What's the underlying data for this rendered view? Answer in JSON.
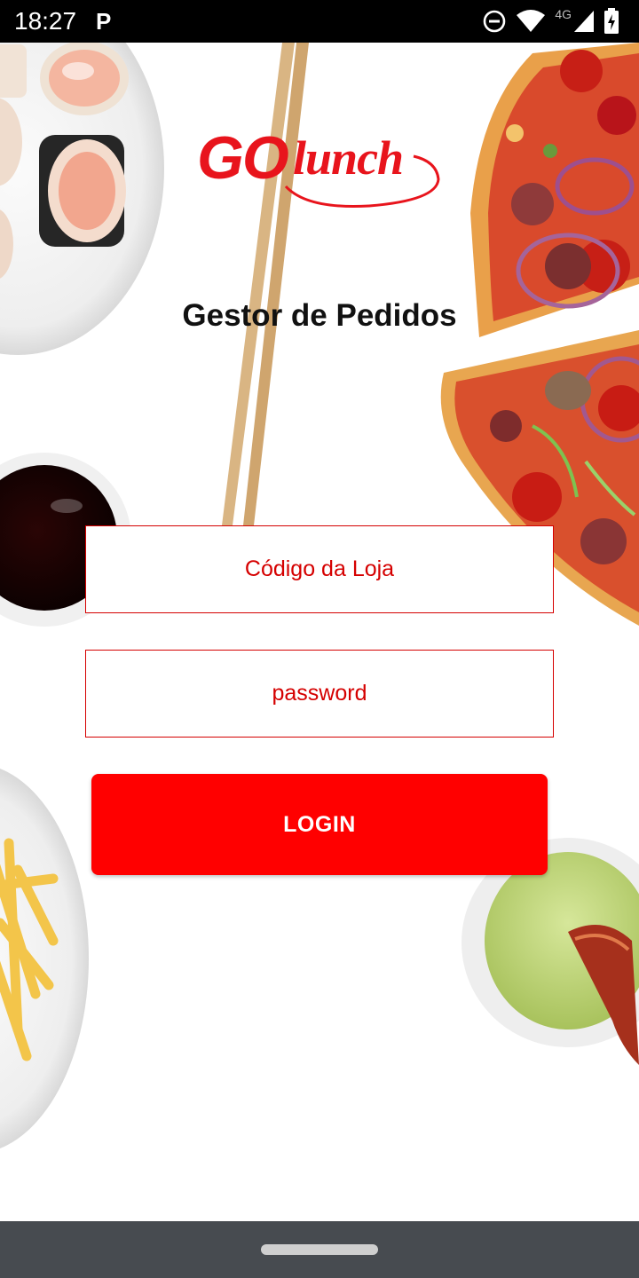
{
  "status_bar": {
    "time": "18:27",
    "notification": "P",
    "network": "4G",
    "icons": [
      "dnd-icon",
      "wifi-icon",
      "signal-icon",
      "battery-charging-icon"
    ]
  },
  "app": {
    "logo_text_1": "GO",
    "logo_text_2": "lunch",
    "title": "Gestor de Pedidos"
  },
  "form": {
    "store_code_placeholder": "Código da Loja",
    "password_placeholder": "password",
    "login_label": "LOGIN"
  },
  "colors": {
    "brand_red": "#e8141c",
    "button_red": "#ff0000",
    "field_border": "#d50000",
    "nav_bar": "#474b50"
  }
}
